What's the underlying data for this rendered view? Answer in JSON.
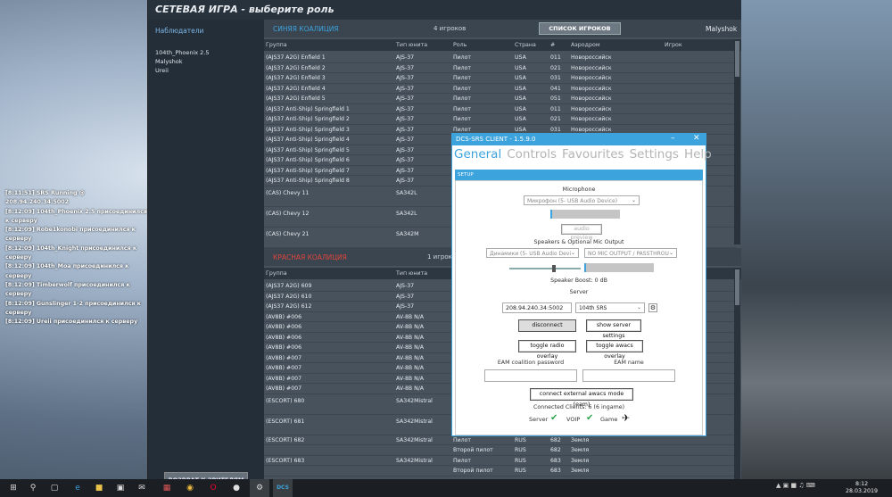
{
  "chat": [
    "[8:11:51] SRS Running @ 208.94.240.34:5002",
    "[8:12:09] 104th_Phoenix 2.5 присоединился к серверу",
    "[8:12:09] Robe1konobi присоединился к серверу",
    "[8:12:09] 104th_Knight присоединился к серверу",
    "[8:12:09] 104th_Moa присоединился к серверу",
    "[8:12:09] Timberwolf присоединился к серверу",
    "[8:12:09] Gunslinger 1-2 присоединился к серверу",
    "[8:12:09] Ureii присоединился к серверу"
  ],
  "game": {
    "title": "СЕТЕВАЯ ИГРА - выберите роль",
    "spectators_title": "Наблюдатели",
    "spectators": [
      "104th_Phoenix 2.5",
      "Malyshok",
      "Ureii"
    ],
    "back_button": "ВОЗВРАТ К ЗРИТЕЛЯМ",
    "player_list_button": "СПИСОК ИГРОКОВ",
    "player_name": "Malyshok",
    "columns": [
      "Группа",
      "Тип юнита",
      "Роль",
      "Страна",
      "#",
      "Аэродром",
      "Игрок"
    ],
    "blue": {
      "name": "СИНЯЯ КОАЛИЦИЯ",
      "count": "4 игроков",
      "color": "#3ca3dd",
      "rows": [
        [
          "(AJS37 A2G) Enfield 1",
          "AJS-37",
          "Пилот",
          "USA",
          "011",
          "Новороссийск",
          ""
        ],
        [
          "(AJS37 A2G) Enfield 2",
          "AJS-37",
          "Пилот",
          "USA",
          "021",
          "Новороссийск",
          ""
        ],
        [
          "(AJS37 A2G) Enfield 3",
          "AJS-37",
          "Пилот",
          "USA",
          "031",
          "Новороссийск",
          ""
        ],
        [
          "(AJS37 A2G) Enfield 4",
          "AJS-37",
          "Пилот",
          "USA",
          "041",
          "Новороссийск",
          ""
        ],
        [
          "(AJS37 A2G) Enfield 5",
          "AJS-37",
          "Пилот",
          "USA",
          "051",
          "Новороссийск",
          ""
        ],
        [
          "(AJS37 Anti-Ship) Springfield 1",
          "AJS-37",
          "Пилот",
          "USA",
          "011",
          "Новороссийск",
          ""
        ],
        [
          "(AJS37 Anti-Ship) Springfield 2",
          "AJS-37",
          "Пилот",
          "USA",
          "021",
          "Новороссийск",
          ""
        ],
        [
          "(AJS37 Anti-Ship) Springfield 3",
          "AJS-37",
          "Пилот",
          "USA",
          "031",
          "Новороссийск",
          ""
        ],
        [
          "(AJS37 Anti-Ship) Springfield 4",
          "AJS-37",
          "",
          "",
          "",
          "",
          ""
        ],
        [
          "(AJS37 Anti-Ship) Springfield 5",
          "AJS-37",
          "",
          "",
          "",
          "",
          ""
        ],
        [
          "(AJS37 Anti-Ship) Springfield 6",
          "AJS-37",
          "",
          "",
          "",
          "",
          ""
        ],
        [
          "(AJS37 Anti-Ship) Springfield 7",
          "AJS-37",
          "",
          "",
          "",
          "",
          ""
        ],
        [
          "(AJS37 Anti-Ship) Springfield 8",
          "AJS-37",
          "",
          "",
          "",
          "",
          ""
        ]
      ],
      "tall_rows": [
        [
          "(CAS) Chevy 11",
          "SA342L"
        ],
        [
          "(CAS) Chevy 12",
          "SA342L"
        ],
        [
          "(CAS) Chevy 21",
          "SA342M"
        ]
      ]
    },
    "red": {
      "name": "КРАСНАЯ КОАЛИЦИЯ",
      "count": "1 игроков",
      "color": "#e0443c",
      "rows": [
        [
          "(AJS37 A2G) 609",
          "AJS-37"
        ],
        [
          "(AJS37 A2G) 610",
          "AJS-37"
        ],
        [
          "(AJS37 A2G) 612",
          "AJS-37"
        ],
        [
          "(AV8B) #006",
          "AV-8B N/A"
        ],
        [
          "(AV8B) #006",
          "AV-8B N/A"
        ],
        [
          "(AV8B) #006",
          "AV-8B N/A"
        ],
        [
          "(AV8B) #006",
          "AV-8B N/A"
        ],
        [
          "(AV8B) #007",
          "AV-8B N/A"
        ],
        [
          "(AV8B) #007",
          "AV-8B N/A"
        ],
        [
          "(AV8B) #007",
          "AV-8B N/A"
        ],
        [
          "(AV8B) #007",
          "AV-8B N/A"
        ]
      ],
      "tall_rows": [
        [
          "(ESCORT) 680",
          "SA342Mistral"
        ],
        [
          "(ESCORT) 681",
          "SA342Mistral"
        ]
      ],
      "escort": [
        [
          "(ESCORT) 682",
          "SA342Mistral",
          "Пилот",
          "RUS",
          "682",
          "Земля"
        ],
        [
          "",
          "",
          "Второй пилот",
          "RUS",
          "682",
          "Земля"
        ],
        [
          "(ESCORT) 683",
          "SA342Mistral",
          "Пилот",
          "RUS",
          "683",
          "Земля"
        ],
        [
          "",
          "",
          "Второй пилот",
          "RUS",
          "683",
          "Земля"
        ]
      ]
    }
  },
  "srs": {
    "title": "DCS-SRS CLIENT - 1.5.9.0",
    "tabs": [
      "General",
      "Controls",
      "Favourites",
      "Settings",
      "Help"
    ],
    "setup_label": "SETUP",
    "microphone_label": "Microphone",
    "microphone_device": "Микрофон (5- USB Audio Device)",
    "audio_preview": "audio preview",
    "speakers_label": "Speakers & Optional Mic Output",
    "speaker_device": "Динамики (5- USB Audio Devi",
    "mic_output": "NO MIC OUTPUT / PASSTHROU",
    "speaker_boost": "Speaker Boost:  0 dB",
    "server_label": "Server",
    "server_address": "208.94.240.34:5002",
    "server_name": "104th SRS",
    "disconnect": "disconnect",
    "show_server_settings": "show server settings",
    "toggle_radio_overlay": "toggle radio overlay",
    "toggle_awacs_overlay": "toggle awacs overlay",
    "eam_password_label": "EAM coalition password",
    "eam_name_label": "EAM name",
    "connect_eam": "connect external awacs mode (eam)",
    "connected_clients": "Connected Clients:   6 (6 ingame)",
    "status_server": "Server",
    "status_voip": "VOIP",
    "status_game": "Game",
    "mic_level": 0.02,
    "speaker_slider": 0.6,
    "speaker_level": 0.02
  },
  "taskbar": {
    "time": "8:12",
    "date": "28.03.2019"
  }
}
